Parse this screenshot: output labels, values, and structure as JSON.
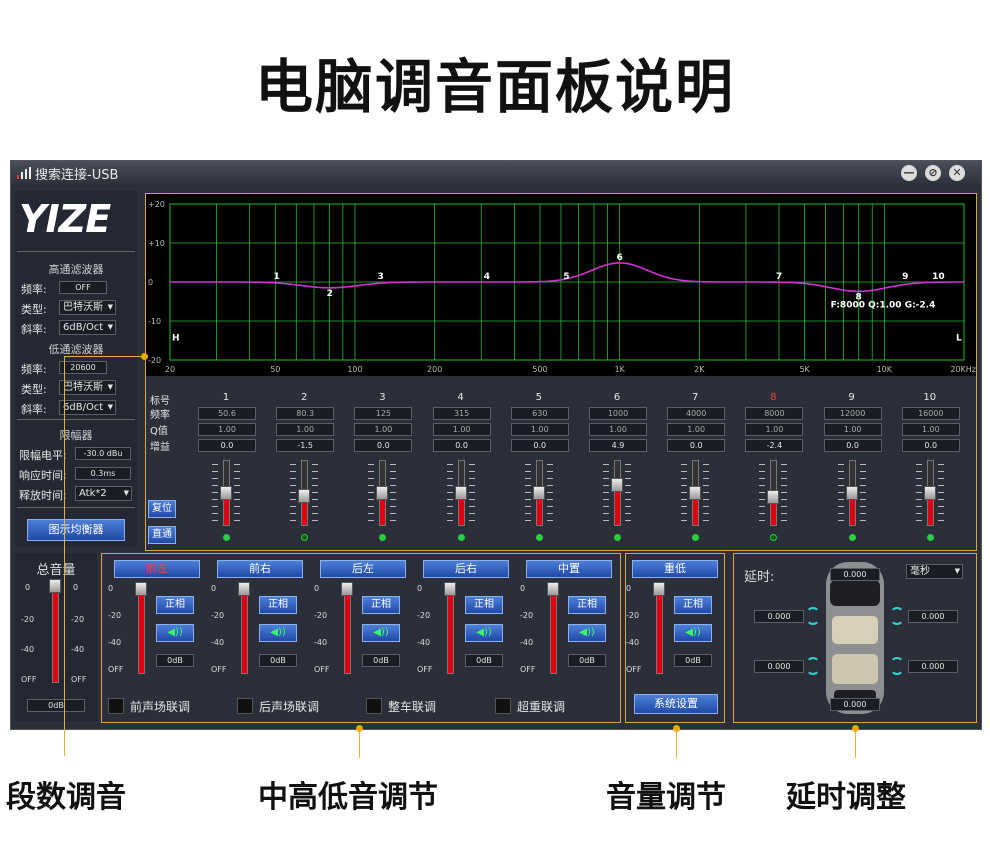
{
  "headline": "电脑调音面板说明",
  "window": {
    "title": "搜索连接-USB",
    "btn_min": "—",
    "btn_restore": "⊘",
    "btn_close": "✕"
  },
  "logo": "YIZE",
  "sidebar": {
    "hp_title": "高通滤波器",
    "hp_freq_label": "频率:",
    "hp_freq_value": "OFF",
    "hp_type_label": "类型:",
    "hp_type_value": "巴特沃斯",
    "hp_slope_label": "斜率:",
    "hp_slope_value": "6dB/Oct",
    "lp_title": "低通滤波器",
    "lp_freq_label": "频率:",
    "lp_freq_value": "20600",
    "lp_type_label": "类型:",
    "lp_type_value": "巴特沃斯",
    "lp_slope_label": "斜率:",
    "lp_slope_value": "6dB/Oct",
    "lim_title": "限幅器",
    "lim_level_label": "限幅电平:",
    "lim_level_value": "-30.0 dBu",
    "lim_resp_label": "响应时间:",
    "lim_resp_value": "0.3ms",
    "lim_rel_label": "释放时间:",
    "lim_rel_value": "Atk*2",
    "eq_button": "图示均衡器"
  },
  "eq_chart": {
    "y_ticks": [
      "+20",
      "+10",
      "0",
      "-10",
      "-20"
    ],
    "x_ticks": [
      "20",
      "50",
      "100",
      "200",
      "500",
      "1K",
      "2K",
      "5K",
      "10K",
      "20KHz"
    ],
    "h_label": "H",
    "l_label": "L",
    "info": "F:8000 Q:1.00 G:-2.4"
  },
  "chart_data": {
    "type": "line",
    "xscale": "log",
    "xlim": [
      20,
      20000
    ],
    "ylim": [
      -20,
      20
    ],
    "points": [
      {
        "label": "1",
        "x": 50.6,
        "y": 0.0
      },
      {
        "label": "2",
        "x": 80.3,
        "y": -1.5
      },
      {
        "label": "3",
        "x": 125,
        "y": 0.0
      },
      {
        "label": "4",
        "x": 315,
        "y": 0.0
      },
      {
        "label": "5",
        "x": 630,
        "y": 0.0
      },
      {
        "label": "6",
        "x": 1000,
        "y": 4.9
      },
      {
        "label": "7",
        "x": 4000,
        "y": 0.0
      },
      {
        "label": "8",
        "x": 8000,
        "y": -2.4
      },
      {
        "label": "9",
        "x": 12000,
        "y": 0.0
      },
      {
        "label": "10",
        "x": 16000,
        "y": 0.0
      }
    ]
  },
  "bands": {
    "row_labels": [
      "标号",
      "频率",
      "Q值",
      "增益"
    ],
    "items": [
      {
        "num": "1",
        "freq": "50.6",
        "q": "1.00",
        "gain": "0.0",
        "level": 0.5,
        "active": true,
        "selected": false
      },
      {
        "num": "2",
        "freq": "80.3",
        "q": "1.00",
        "gain": "-1.5",
        "level": 0.46,
        "active": false,
        "selected": false
      },
      {
        "num": "3",
        "freq": "125",
        "q": "1.00",
        "gain": "0.0",
        "level": 0.5,
        "active": true,
        "selected": false
      },
      {
        "num": "4",
        "freq": "315",
        "q": "1.00",
        "gain": "0.0",
        "level": 0.5,
        "active": true,
        "selected": false
      },
      {
        "num": "5",
        "freq": "630",
        "q": "1.00",
        "gain": "0.0",
        "level": 0.5,
        "active": true,
        "selected": false
      },
      {
        "num": "6",
        "freq": "1000",
        "q": "1.00",
        "gain": "4.9",
        "level": 0.62,
        "active": true,
        "selected": false
      },
      {
        "num": "7",
        "freq": "4000",
        "q": "1.00",
        "gain": "0.0",
        "level": 0.5,
        "active": true,
        "selected": false
      },
      {
        "num": "8",
        "freq": "8000",
        "q": "1.00",
        "gain": "-2.4",
        "level": 0.44,
        "active": false,
        "selected": true
      },
      {
        "num": "9",
        "freq": "12000",
        "q": "1.00",
        "gain": "0.0",
        "level": 0.5,
        "active": true,
        "selected": false
      },
      {
        "num": "10",
        "freq": "16000",
        "q": "1.00",
        "gain": "0.0",
        "level": 0.5,
        "active": true,
        "selected": false
      }
    ],
    "reset_button": "复位",
    "bypass_button": "直通"
  },
  "master": {
    "title": "总音量",
    "ticks": [
      "0",
      "-20",
      "-40",
      "OFF"
    ],
    "value": "0dB",
    "level": 1.0
  },
  "channels": {
    "items": [
      {
        "name": "前左",
        "phase": "正相",
        "value": "0dB",
        "level": 1.0,
        "active": true
      },
      {
        "name": "前右",
        "phase": "正相",
        "value": "0dB",
        "level": 1.0,
        "active": false
      },
      {
        "name": "后左",
        "phase": "正相",
        "value": "0dB",
        "level": 1.0,
        "active": false
      },
      {
        "name": "后右",
        "phase": "正相",
        "value": "0dB",
        "level": 1.0,
        "active": false
      },
      {
        "name": "中置",
        "phase": "正相",
        "value": "0dB",
        "level": 1.0,
        "active": false
      },
      {
        "name": "重低",
        "phase": "正相",
        "value": "0dB",
        "level": 1.0,
        "active": false
      }
    ],
    "ticks": [
      "0",
      "-20",
      "-40",
      "OFF"
    ],
    "links": [
      "前声场联调",
      "后声场联调",
      "整车联调",
      "超重联调"
    ],
    "system_button": "系统设置"
  },
  "delay": {
    "title": "延时:",
    "unit": "毫秒",
    "top": "0.000",
    "front_left": "0.000",
    "front_right": "0.000",
    "rear_left": "0.000",
    "rear_right": "0.000",
    "bottom": "0.000"
  },
  "callouts": [
    "段数调音",
    "中高低音调节",
    "音量调节",
    "延时调整"
  ],
  "colors": {
    "accent_orange": "#d9a441",
    "grid_green": "#1fbf2a",
    "curve_magenta": "#d62fd6",
    "fader_red": "#e00012",
    "led_green": "#28d13a"
  }
}
